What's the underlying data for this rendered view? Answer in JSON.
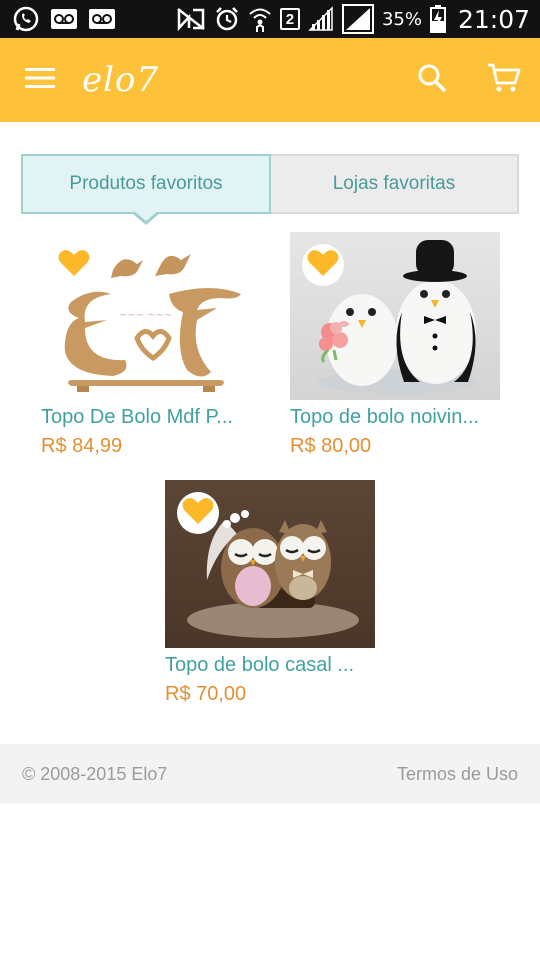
{
  "status_bar": {
    "battery_percent": "35%",
    "sim_slot": "2",
    "clock": "21:07",
    "icons": [
      "whatsapp-icon",
      "voicemail-icon",
      "voicemail-icon",
      "no-nfc-icon",
      "alarm-icon",
      "wifi-icon",
      "signal-icon",
      "signal-icon",
      "battery-charging-icon"
    ]
  },
  "app_bar": {
    "logo_text": "elo7",
    "brand_color": "#fdc23a",
    "icons": [
      "menu-icon",
      "search-icon",
      "cart-icon"
    ]
  },
  "tabs": [
    {
      "label": "Produtos favoritos",
      "active": true
    },
    {
      "label": "Lojas favoritas",
      "active": false
    }
  ],
  "products": [
    {
      "title": "Topo De Bolo Mdf P...",
      "price": "R$ 84,99",
      "favorited": true
    },
    {
      "title": "Topo de bolo noivin...",
      "price": "R$ 80,00",
      "favorited": true
    },
    {
      "title": "Topo de bolo casal ...",
      "price": "R$ 70,00",
      "favorited": true
    }
  ],
  "footer": {
    "copyright": "© 2008-2015 Elo7",
    "terms_link": "Termos de Uso"
  },
  "colors": {
    "accent_teal": "#3fa2a2",
    "price_orange": "#e38f33",
    "heart_yellow": "#fbb829"
  }
}
